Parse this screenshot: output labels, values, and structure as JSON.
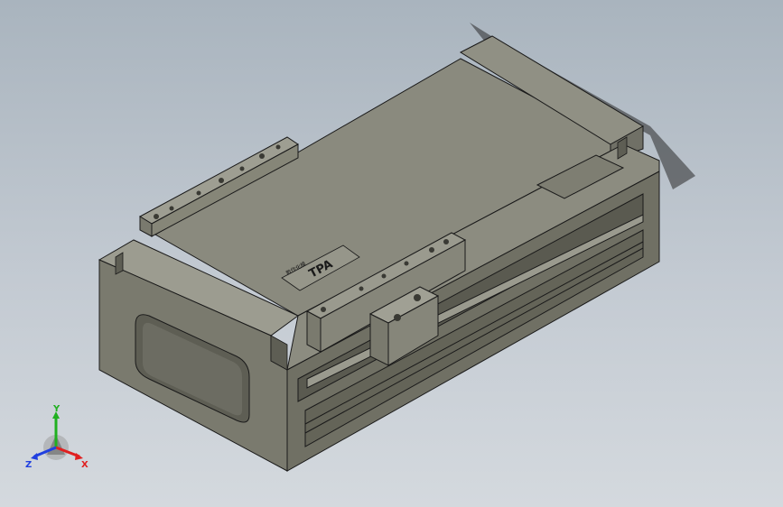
{
  "viewport": {
    "background_top": "#a9b4be",
    "background_bottom": "#d4d9de"
  },
  "model": {
    "part_color": "#8e8e82",
    "top_color": "#9a9a8e",
    "front_color": "#76766a",
    "side_color": "#6a6a60",
    "edge_color": "#1a1a1a",
    "name_plate_text": "TPA",
    "name_plate_subtext": "数作化模"
  },
  "triad": {
    "x_label": "X",
    "y_label": "Y",
    "z_label": "Z",
    "x_color": "#e02020",
    "y_color": "#20b020",
    "z_color": "#2040e0"
  }
}
